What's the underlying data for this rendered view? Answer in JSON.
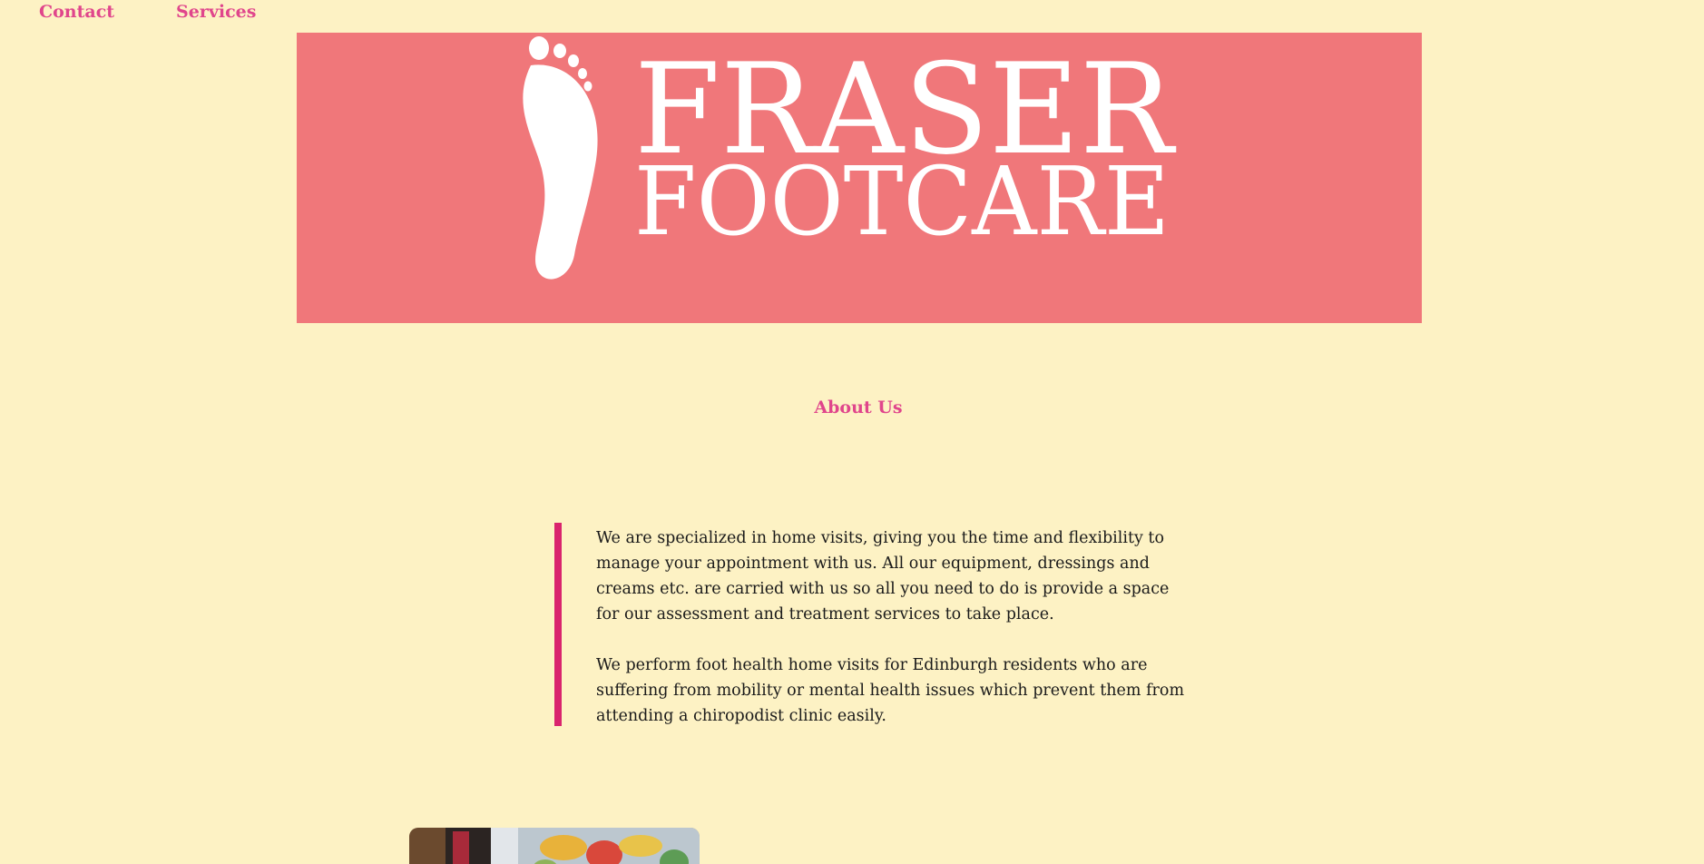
{
  "nav": {
    "contact_label": "Contact",
    "services_label": "Services"
  },
  "banner": {
    "line1": "FRASER",
    "line2": "FOOTCARE",
    "background_color": "#f0777a",
    "icon": "footprint-icon"
  },
  "about": {
    "heading": "About Us",
    "paragraph1": "We are specialized in home visits, giving you the time and flexibility to manage your appointment with us. All our equipment, dressings and creams etc. are carried with us so all you need to do is provide a space for our assessment and treatment services to take place.",
    "paragraph2": "We perform foot health home visits for Edinburgh residents who are suffering from mobility or mental health issues which prevent them from attending a chiropodist clinic easily."
  },
  "colors": {
    "page_background": "#fdf2c4",
    "accent": "#e0468c",
    "quote_bar": "#d9246e"
  }
}
